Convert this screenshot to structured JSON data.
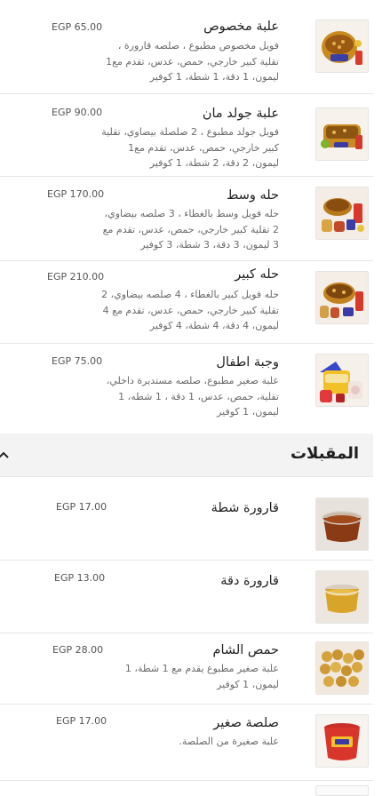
{
  "items_top": [
    {
      "title": "علبة مخصوص",
      "desc": "فويل مخصوص مطبوع ، صلصه قارورة ، تقلية كبير خارجي، حمص، عدس، تقدم مع1 ليمون، 1 دقة، 1 شطة، 1 كوفير",
      "price": "EGP 65.00",
      "image": "food-container-photo"
    },
    {
      "title": "علبة جولد مان",
      "desc": "فويل جولد مطبوع ، 2 صلصلة بيضاوي، تقلية كبير خارجي، حمص، عدس، تقدم مع1 ليمون، 2 دقة، 2 شطة، 1 كوفير",
      "price": "EGP 90.00",
      "image": "food-container-photo"
    },
    {
      "title": "حله وسط",
      "desc": "حله فويل وسط بالغطاء ، 3 صلصه بيضاوي، 2 تقلية كبير خارجي، حمص، عدس، تقدم مع 3 ليمون، 3 دقة، 3 شطة، 3 كوفير",
      "price": "EGP 170.00",
      "image": "pot-set-photo"
    },
    {
      "title": "حله كبير",
      "desc": "حله فويل كبير بالغطاء ، 4 صلصه بيضاوي، 2 تقلية كبير خارجي، حمص، عدس، تقدم مع 4 ليمون، 4 دقة، 4 شطة، 4 كوفير",
      "price": "EGP 210.00",
      "image": "pot-set-photo"
    },
    {
      "title": "وجبة اطفال",
      "desc": "علبة صغير مطبوع، صلصه مستديرة داخلي، تقلية، حمص، عدس، 1 دقة ، 1 شطه، 1 ليمون، 1 كوفير",
      "price": "EGP 75.00",
      "image": "kids-meal-photo"
    }
  ],
  "section": {
    "title": "المقبلات"
  },
  "items_bottom": [
    {
      "title": "قارورة شطة",
      "desc": "",
      "price": "EGP 17.00",
      "image": "chili-jar-photo"
    },
    {
      "title": "قارورة دقة",
      "desc": "",
      "price": "EGP 13.00",
      "image": "dakka-jar-photo"
    },
    {
      "title": "حمص الشام",
      "desc": "علبة صغير مطبوع يقدم مع 1 شطة، 1 ليمون، 1 كوفير",
      "price": "EGP 28.00",
      "image": "chickpeas-photo"
    },
    {
      "title": "صلصة صغير",
      "desc": "علبة صغيرة من الصلصة.",
      "price": "EGP 17.00",
      "image": "sauce-cup-photo"
    }
  ]
}
